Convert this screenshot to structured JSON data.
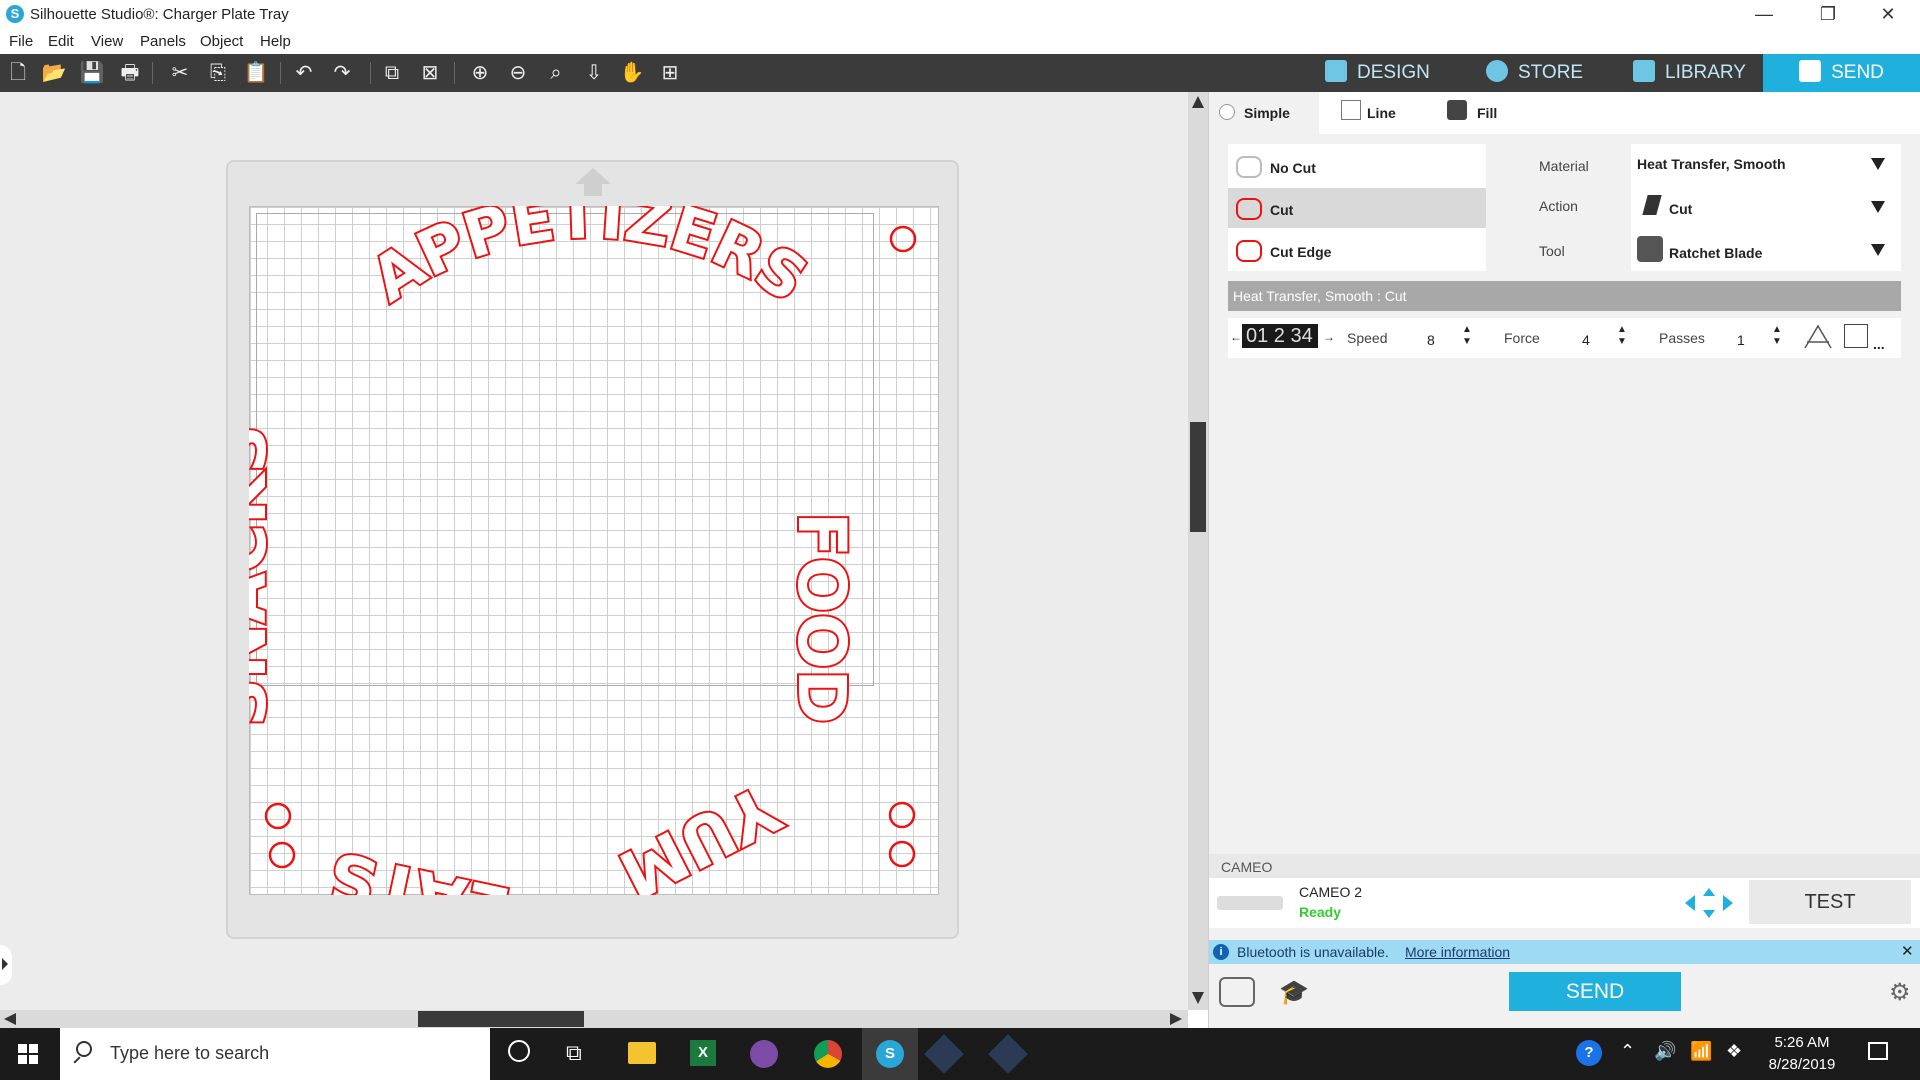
{
  "window": {
    "title": "Silhouette Studio®: Charger Plate Tray",
    "minimize": "—",
    "restore": "❐",
    "close": "✕"
  },
  "menu": [
    "File",
    "Edit",
    "View",
    "Panels",
    "Object",
    "Help"
  ],
  "toolbar_icons": [
    "new-icon",
    "open-icon",
    "save-icon",
    "print-icon",
    "cut-icon",
    "copy-icon",
    "paste-icon",
    "undo-icon",
    "redo-icon",
    "group-icon",
    "ungroup-icon",
    "zoom-in-icon",
    "zoom-out-icon",
    "zoom-fit-icon",
    "pan-down-icon",
    "hand-icon",
    "zoom-area-icon"
  ],
  "nav_tabs": {
    "design": "DESIGN",
    "store": "STORE",
    "library": "LIBRARY",
    "send": "SEND"
  },
  "design_words": {
    "top": "APPETIZERS",
    "right": "FOOD",
    "left": "SNACKS",
    "bottom_left": "EATS",
    "bottom_right": "YUM"
  },
  "colors": {
    "cut_line": "#ee1111",
    "send_accent": "#20b0dd",
    "ready": "#33cc33",
    "info_bar": "#9fdaf4"
  },
  "panel": {
    "modes": {
      "simple": "Simple",
      "line": "Line",
      "fill": "Fill"
    },
    "cut_styles": {
      "no_cut": "No Cut",
      "cut": "Cut",
      "cut_edge": "Cut Edge"
    },
    "material": {
      "label": "Material",
      "value": "Heat Transfer, Smooth"
    },
    "action": {
      "label": "Action",
      "value": "Cut"
    },
    "tool": {
      "label": "Tool",
      "value": "Ratchet Blade"
    },
    "summary": "Heat Transfer, Smooth : Cut",
    "blade_digits": "01 2 34",
    "speed": {
      "label": "Speed",
      "value": "8"
    },
    "force": {
      "label": "Force",
      "value": "4"
    },
    "passes": {
      "label": "Passes",
      "value": "1"
    },
    "more": "...",
    "device_section": "CAMEO",
    "device_name": "CAMEO 2",
    "device_status": "Ready",
    "test_label": "TEST",
    "info_text": "Bluetooth is unavailable.",
    "info_link": "More information",
    "send_label": "SEND"
  },
  "taskbar": {
    "search_placeholder": "Type here to search",
    "time": "5:26 AM",
    "date": "8/28/2019"
  }
}
